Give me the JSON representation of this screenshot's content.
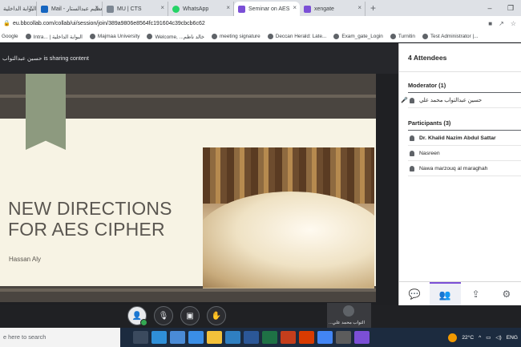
{
  "browser": {
    "tabs": [
      {
        "title": "البوابة الداخلية",
        "color": "#2b6fb3",
        "active": false
      },
      {
        "title": "Mail - تعظيم عبدالستار",
        "color": "#1565c0",
        "active": false
      },
      {
        "title": "MU | CTS",
        "color": "#7d8793",
        "active": false
      },
      {
        "title": "WhatsApp",
        "color": "#25d366",
        "active": false
      },
      {
        "title": "Seminar on AES",
        "color": "#7b4fd6",
        "active": true
      },
      {
        "title": "xengate",
        "color": "#7b4fd6",
        "active": false
      }
    ],
    "url": "eu.bbcollab.com/collab/ui/session/join/389a9806e8564fc191604c39cbcb6c62",
    "bookmarks": [
      "Google",
      "Intra... | البوابة الداخلية",
      "Majmaa University",
      "Welcome, ...خالد ناظم",
      "meeting signature",
      "Deccan Herald: Late...",
      "Exam_gate_Login",
      "Turnitin",
      "Test Administrator |..."
    ]
  },
  "session": {
    "sharing_text": "حسين عبدالتواب is sharing content"
  },
  "slide": {
    "title_line1": "NEW DIRECTIONS",
    "title_line2": "FOR AES CIPHER",
    "author": "Hassan Aly"
  },
  "selfview": {
    "name": "...التواب محمد علي"
  },
  "attendees": {
    "header": "4 Attendees",
    "moderator_heading": "Moderator (1)",
    "moderators": [
      "حسين عبدالتواب محمد علي"
    ],
    "participants_heading": "Participants (3)",
    "participants": [
      "Dr. Khalid Nazim Abdul Sattar",
      "Nasreen",
      "Nawa marzouq al maraghah"
    ]
  },
  "taskbar": {
    "search_placeholder": "e here to search",
    "temperature": "22°C",
    "language": "ENG"
  },
  "colors": {
    "accent": "#7b4fd6",
    "taskbar": "#1c2b3f"
  }
}
